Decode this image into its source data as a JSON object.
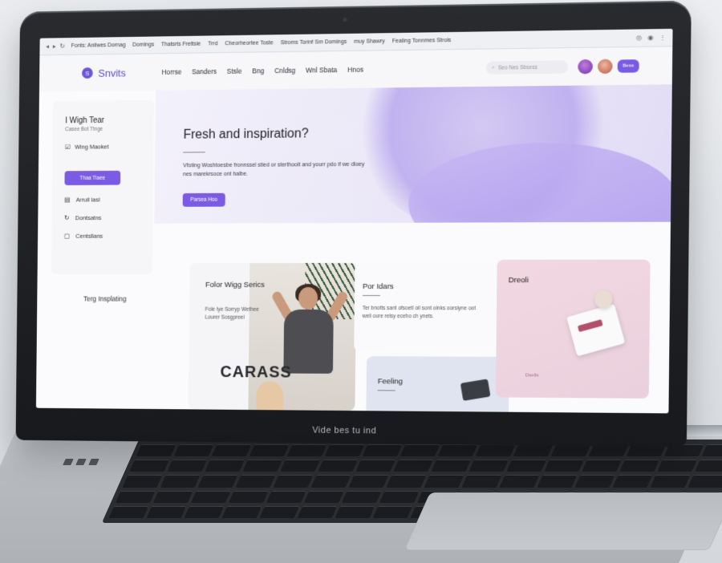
{
  "browser": {
    "tabs": [
      "Fonts: Anilwes Dornag",
      "Domings",
      "Thatsrts Frettsie",
      "Trrd",
      "Cheorheortee Toste",
      "Stroms Torinf Sm Domings"
    ],
    "right_tab": "muy Shawry",
    "right_tab2": "Fealing Tonnmes Strois"
  },
  "site": {
    "logo": "Snvits",
    "logo_mark": "S",
    "nav": [
      "Horrse",
      "Sanders",
      "Stsle",
      "Bng",
      "Cnldsg",
      "Wnl Sbata",
      "Hnos"
    ],
    "search_placeholder": "Seo Nes Sbsess",
    "cta": "Bess"
  },
  "hero": {
    "title": "Fresh and inspiration?",
    "text": "Vfoting Woshtoesbe fronnssel stied or sterthoolt and yourr pdo if we dloey nes marekrsoce ont halbe.",
    "button": "Parsea Hoo"
  },
  "sidebar": {
    "title": "I Wigh Tear",
    "subtitle": "Casee Bot Ttnge",
    "checkbox": "Wing Maoket",
    "pill": "Thaa Tlaee",
    "items": [
      "Arrull lasl",
      "Dontsatns",
      "Centsllans"
    ],
    "bottom": "Terg Insplating"
  },
  "cards": {
    "card1_title": "Folor Wigg Serics",
    "card1_text": "Fole Iye Sorryp Wethee Lourer Sosgpreel",
    "card1_overlay": "CARASS",
    "card2_title": "Por Idars",
    "card2_text": "Ter bnotts sant ofsoetl oil sont oinks oorsiyne oot weil oure reisy eceho ch ynets.",
    "card3_title": "Feeling",
    "card4_title": "Dreoli",
    "card4_foot": "Dsells"
  },
  "laptop": {
    "lid_label": "Vide bes tu ind"
  }
}
